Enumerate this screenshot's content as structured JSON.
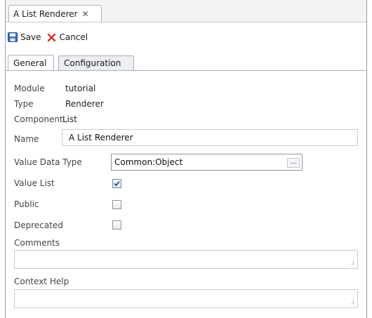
{
  "editor_tab": {
    "title": "A List Renderer",
    "close_glyph": "✕"
  },
  "toolbar": {
    "save_label": "Save",
    "cancel_label": "Cancel"
  },
  "subtabs": [
    {
      "label": "General",
      "active": true
    },
    {
      "label": "Configuration",
      "active": false
    }
  ],
  "form": {
    "module": {
      "label": "Module",
      "value": "tutorial"
    },
    "type": {
      "label": "Type",
      "value": "Renderer"
    },
    "component": {
      "label": "Component",
      "value": "List"
    },
    "name": {
      "label": "Name",
      "value": "A List Renderer"
    },
    "value_data_type": {
      "label": "Value Data Type",
      "value": "Common:Object",
      "browse_label": "..."
    },
    "value_list": {
      "label": "Value List",
      "checked": true
    },
    "public": {
      "label": "Public",
      "checked": false
    },
    "deprecated": {
      "label": "Deprecated",
      "checked": false
    },
    "comments": {
      "label": "Comments",
      "value": ""
    },
    "context_help": {
      "label": "Context Help",
      "value": ""
    }
  },
  "colors": {
    "save_icon": "#3b6fb6",
    "cancel_icon": "#d6332a",
    "check_mark": "#2a4f8a"
  }
}
